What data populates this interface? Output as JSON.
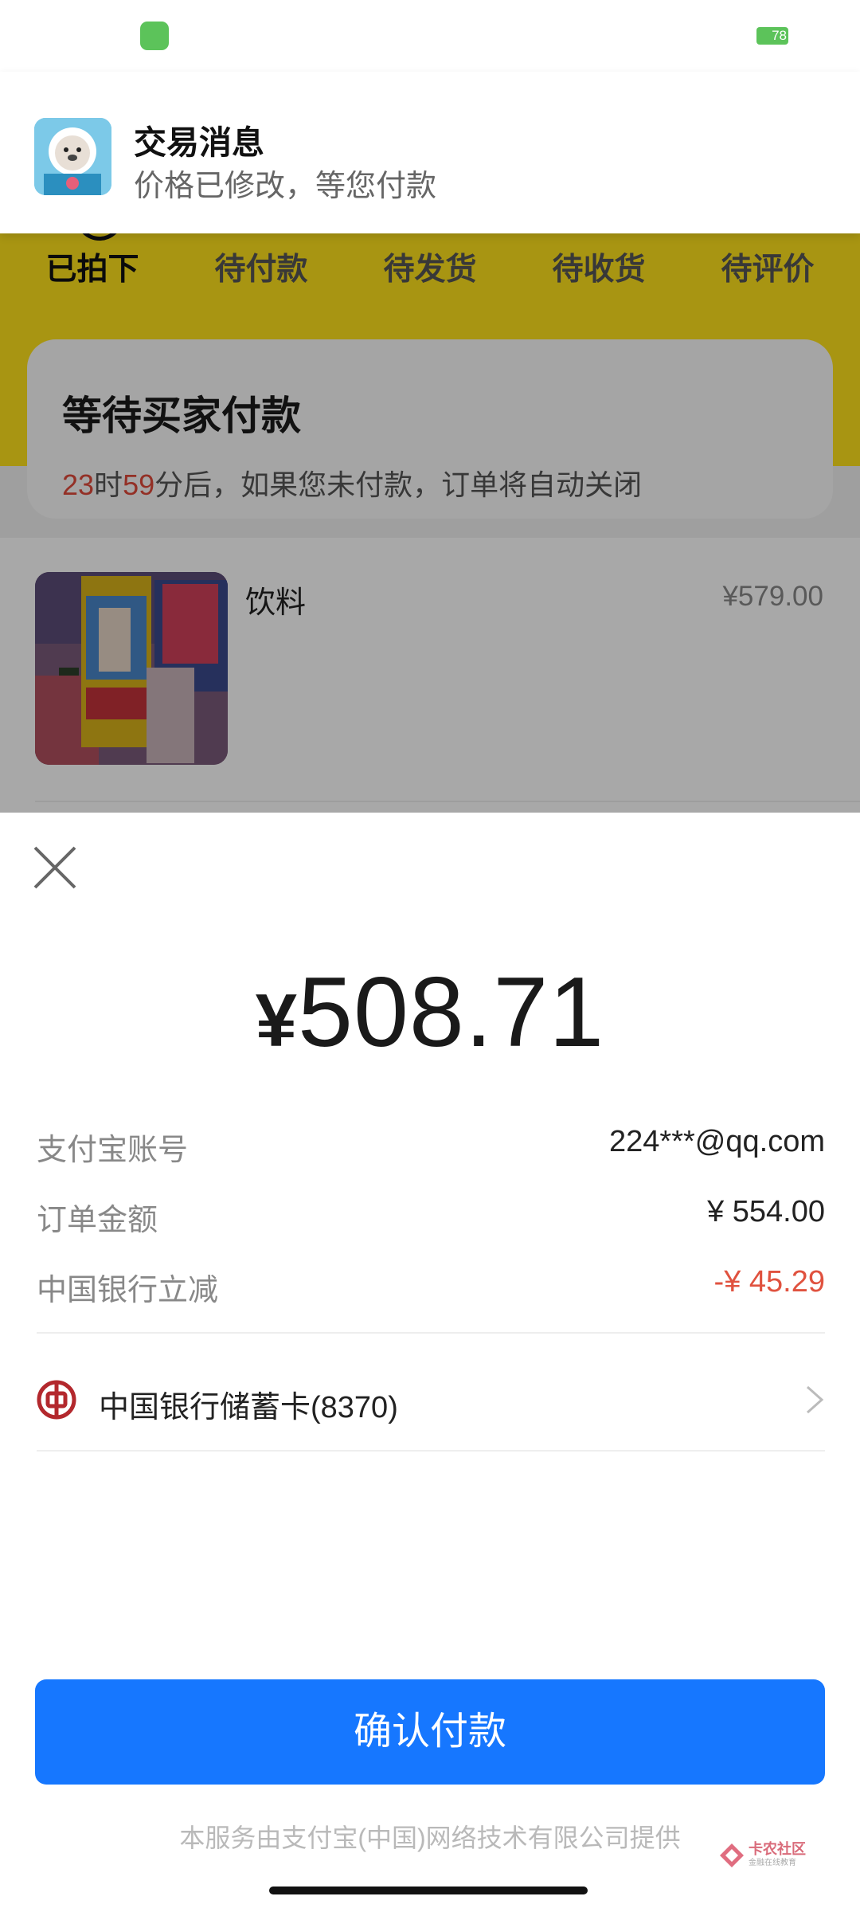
{
  "status_bar": {
    "battery": "78"
  },
  "notification": {
    "app_icon": "seal-mascot-icon",
    "title": "交易消息",
    "body": "价格已修改，等您付款"
  },
  "order_page": {
    "tabs": [
      "已拍下",
      "待付款",
      "待发货",
      "待收货",
      "待评价"
    ],
    "active_tab": "已拍下",
    "status_title": "等待买家付款",
    "countdown": {
      "hours": "23",
      "hours_unit": "时",
      "minutes": "59",
      "suffix": "分后，如果您未付款，订单将自动关闭"
    },
    "item": {
      "name": "饮料",
      "price": "¥579.00"
    }
  },
  "payment": {
    "close_icon": "close-icon",
    "currency_symbol": "¥",
    "amount": "508.71",
    "rows": [
      {
        "label": "支付宝账号",
        "value": "224***@qq.com"
      },
      {
        "label": "订单金额",
        "value": "¥ 554.00"
      },
      {
        "label": "中国银行立减",
        "value": "-¥ 45.29"
      }
    ],
    "payment_method": {
      "icon": "bank-of-china-icon",
      "label": "中国银行储蓄卡(8370)"
    },
    "confirm_label": "确认付款",
    "footer": "本服务由支付宝(中国)网络技术有限公司提供"
  },
  "watermark": {
    "title": "卡农社区",
    "subtitle": "金融在线教育"
  },
  "colors": {
    "yellow": "#ffe21c",
    "accent_blue": "#1677ff",
    "discount_red": "#e0523f",
    "countdown_red": "#e04a3b"
  }
}
